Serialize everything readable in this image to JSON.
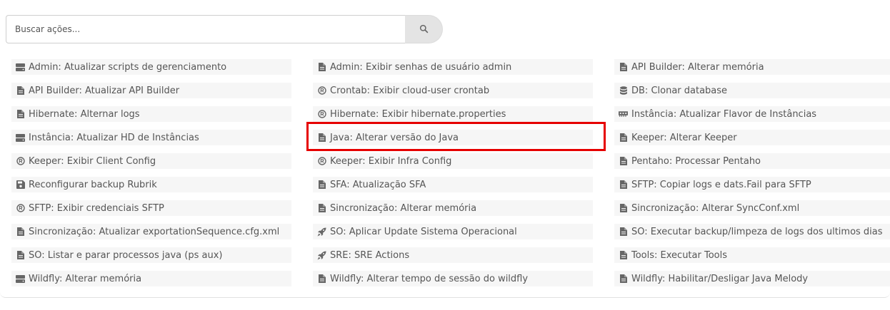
{
  "search": {
    "placeholder": "Buscar ações..."
  },
  "actions": [
    {
      "label": "Admin: Atualizar scripts de gerenciamento",
      "icon": "server-icon"
    },
    {
      "label": "Admin: Exibir senhas de usuário admin",
      "icon": "file-icon"
    },
    {
      "label": "API Builder: Alterar memória",
      "icon": "file-icon"
    },
    {
      "label": "API Builder: Atualizar API Builder",
      "icon": "file-icon"
    },
    {
      "label": "Crontab: Exibir cloud-user crontab",
      "icon": "registered-icon"
    },
    {
      "label": "DB: Clonar database",
      "icon": "database-icon"
    },
    {
      "label": "Hibernate: Alternar logs",
      "icon": "file-icon"
    },
    {
      "label": "Hibernate: Exibir hibernate.properties",
      "icon": "registered-icon"
    },
    {
      "label": "Instância: Atualizar Flavor de Instâncias",
      "icon": "memory-icon"
    },
    {
      "label": "Instância: Atualizar HD de Instâncias",
      "icon": "server-icon"
    },
    {
      "label": "Java: Alterar versão do Java",
      "icon": "file-icon"
    },
    {
      "label": "Keeper: Alterar Keeper",
      "icon": "file-icon"
    },
    {
      "label": "Keeper: Exibir Client Config",
      "icon": "registered-icon"
    },
    {
      "label": "Keeper: Exibir Infra Config",
      "icon": "registered-icon"
    },
    {
      "label": "Pentaho: Processar Pentaho",
      "icon": "file-icon"
    },
    {
      "label": "Reconfigurar backup Rubrik",
      "icon": "save-icon"
    },
    {
      "label": "SFA: Atualização SFA",
      "icon": "file-icon"
    },
    {
      "label": "SFTP: Copiar logs e dats.Fail para SFTP",
      "icon": "file-icon"
    },
    {
      "label": "SFTP: Exibir credenciais SFTP",
      "icon": "registered-icon"
    },
    {
      "label": "Sincronização: Alterar memória",
      "icon": "file-icon"
    },
    {
      "label": "Sincronização: Alterar SyncConf.xml",
      "icon": "file-icon"
    },
    {
      "label": "Sincronização: Atualizar exportationSequence.cfg.xml",
      "icon": "file-icon"
    },
    {
      "label": "SO: Aplicar Update Sistema Operacional",
      "icon": "rocket-icon"
    },
    {
      "label": "SO: Executar backup/limpeza de logs dos ultimos dias",
      "icon": "file-icon"
    },
    {
      "label": "SO: Listar e parar processos java (ps aux)",
      "icon": "file-icon"
    },
    {
      "label": "SRE: SRE Actions",
      "icon": "rocket-icon"
    },
    {
      "label": "Tools: Executar Tools",
      "icon": "file-icon"
    },
    {
      "label": "Wildfly: Alterar memória",
      "icon": "server-icon"
    },
    {
      "label": "Wildfly: Alterar tempo de sessão do wildfly",
      "icon": "file-icon"
    },
    {
      "label": "Wildfly: Habilitar/Desligar Java Melody",
      "icon": "file-icon"
    }
  ],
  "highlighted_action": "Java: Alterar versão do Java",
  "colors": {
    "highlight": "#e60000",
    "item_bg": "#f6f6f6",
    "text": "#555555"
  }
}
